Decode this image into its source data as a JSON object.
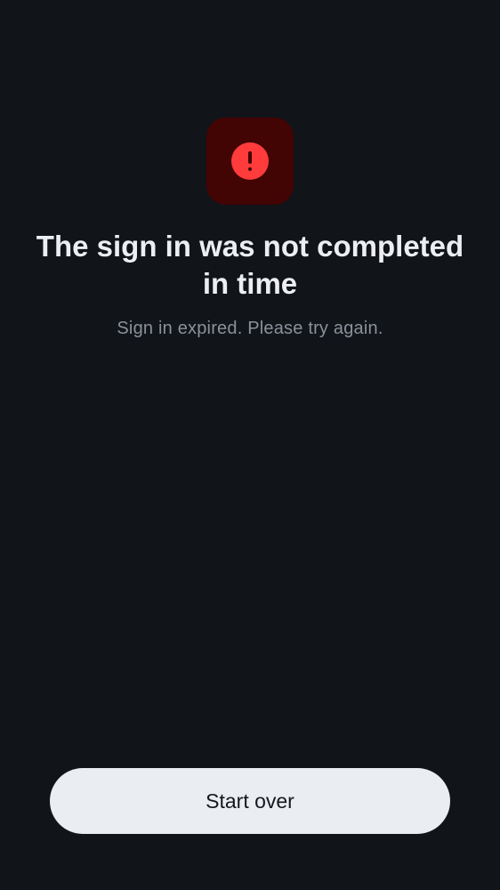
{
  "status": {
    "icon": "error-exclamation-icon",
    "icon_color": "#ff3b3b",
    "tile_color": "#430404"
  },
  "message": {
    "title": "The sign in was not completed in time",
    "subtitle": "Sign in expired. Please try again."
  },
  "actions": {
    "start_over_label": "Start over"
  },
  "colors": {
    "background": "#111419",
    "button_background": "#eaedf2",
    "button_text": "#15181d"
  }
}
